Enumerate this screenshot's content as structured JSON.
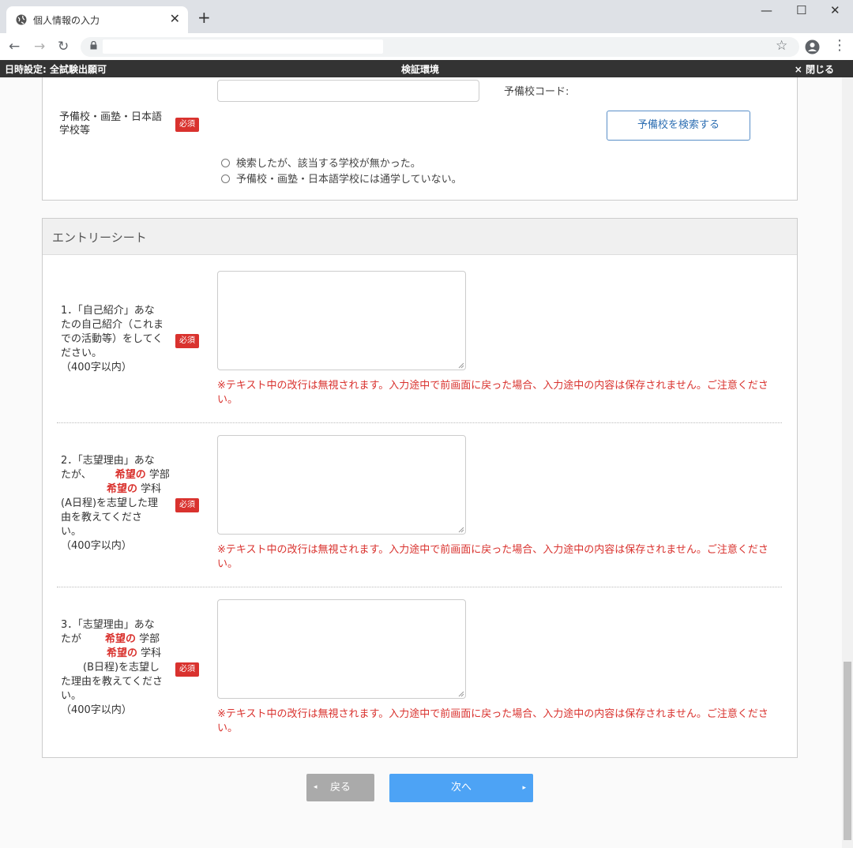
{
  "browser": {
    "tab_title": "個人情報の入力",
    "tab_close": "✕",
    "new_tab": "+",
    "window_controls": {
      "minimize": "—",
      "maximize": "☐",
      "close": "✕"
    },
    "nav": {
      "back": "←",
      "forward": "→",
      "reload": "↻",
      "star": "☆",
      "menu": "⋮"
    }
  },
  "env_bar": {
    "left": "日時設定: 全試験出願可",
    "center": "検証環境",
    "right": "× 閉じる"
  },
  "school_section": {
    "label_line1": "予備校・画塾・日本語",
    "label_line2": "学校等",
    "required": "必須",
    "code_label": "予備校コード:",
    "search_button": "予備校を検索する",
    "radio_options": [
      "検索したが、該当する学校が無かった。",
      "予備校・画塾・日本語学校には通学していない。"
    ]
  },
  "entry_sheet": {
    "title": "エントリーシート",
    "note": "※テキスト中の改行は無視されます。入力途中で前画面に戻った場合、入力途中の内容は保存されません。ご注意ください。",
    "questions": [
      {
        "required": "必須",
        "line1": "1．「自己紹介」あな",
        "line2": "たの自己紹介（これま",
        "line3": "での活動等）をしてく",
        "line4": "ださい。",
        "limit": "（400字以内）"
      },
      {
        "required": "必須",
        "line1": "2．「志望理由」あな",
        "line2a": "たが、",
        "hl1": "希望の",
        "faculty": "学部",
        "hl2": "希望の",
        "dept": "学科",
        "line4": "(A日程)を志望した理",
        "line5": "由を教えてくださ",
        "line6": "い。",
        "limit": "（400字以内）"
      },
      {
        "required": "必須",
        "line1": "3．「志望理由」あな",
        "line2a": "たが",
        "hl1": "希望の",
        "faculty": "学部",
        "hl2": "希望の",
        "dept": "学科",
        "line4": "(B日程)を志望し",
        "line5": "た理由を教えてくださ",
        "line6": "い。",
        "limit": "（400字以内）"
      }
    ]
  },
  "buttons": {
    "back": "戻る",
    "back_arrow": "◂",
    "next": "次へ",
    "next_arrow": "▸"
  },
  "colors": {
    "required_badge": "#d9322e",
    "next_button": "#4da3f5",
    "back_button": "#aaaaaa",
    "env_bar": "#333333"
  }
}
